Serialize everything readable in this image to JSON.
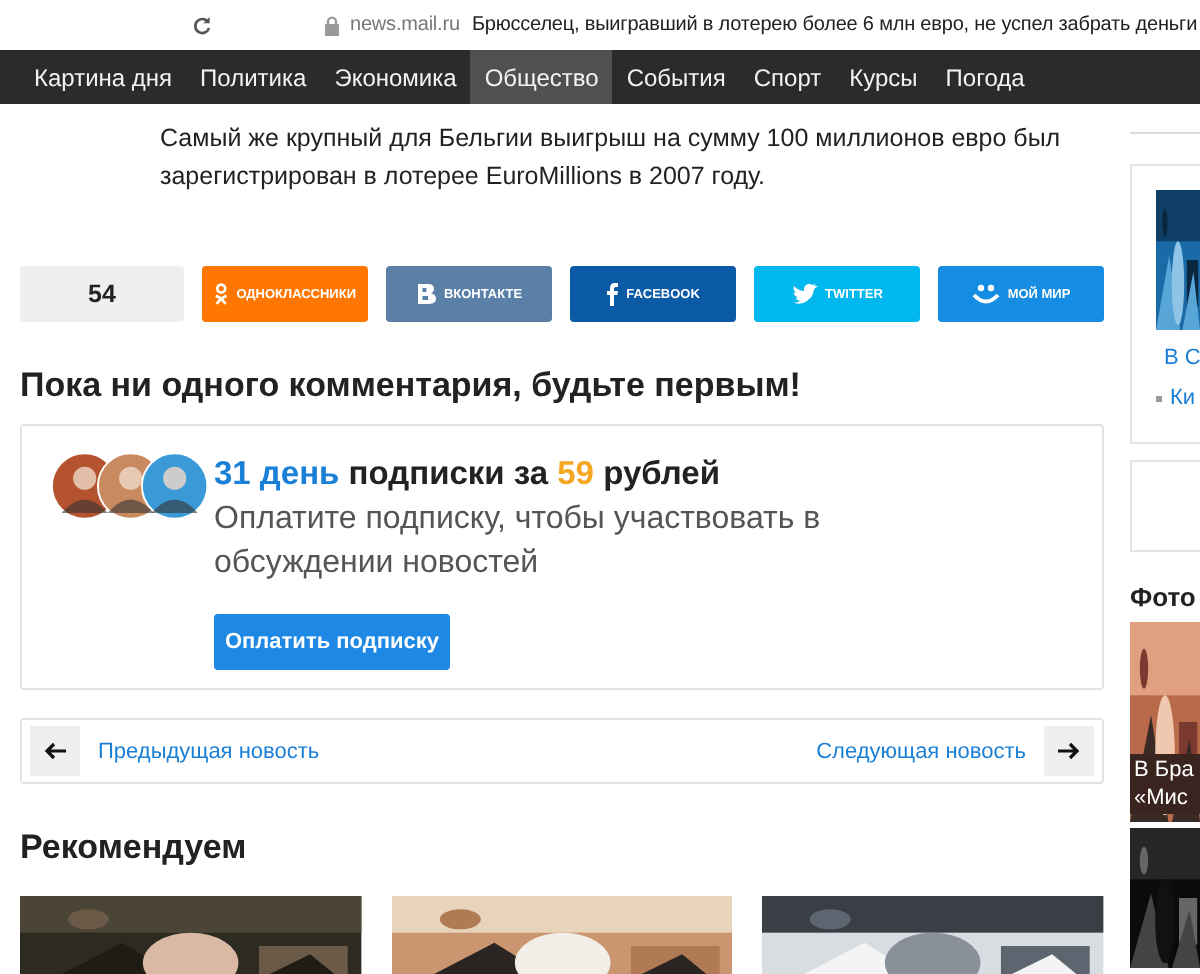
{
  "browser": {
    "url": "news.mail.ru",
    "title": "Брюсселец, выигравший в лотерею более 6 млн евро, не успел забрать деньги"
  },
  "nav": [
    {
      "label": "Картина дня",
      "selected": false
    },
    {
      "label": "Политика",
      "selected": false
    },
    {
      "label": "Экономика",
      "selected": false
    },
    {
      "label": "Общество",
      "selected": true
    },
    {
      "label": "События",
      "selected": false
    },
    {
      "label": "Спорт",
      "selected": false
    },
    {
      "label": "Курсы",
      "selected": false
    },
    {
      "label": "Погода",
      "selected": false
    }
  ],
  "article": {
    "paragraph": "Самый же крупный для Бельгии выигрыш на сумму 100 миллионов евро был зарегистрирован в лотерее EuroMillions в 2007 году."
  },
  "share": {
    "count": "54",
    "buttons": [
      {
        "kind": "ok",
        "label": "ОДНОКЛАССНИКИ"
      },
      {
        "kind": "vk",
        "label": "ВКОНТАКТЕ"
      },
      {
        "kind": "fb",
        "label": "FACEBOOK"
      },
      {
        "kind": "tw",
        "label": "TWITTER"
      },
      {
        "kind": "mm",
        "label": "МОЙ МИР"
      }
    ]
  },
  "comments": {
    "heading": "Пока ни одного комментария, будьте первым!"
  },
  "subscription": {
    "days": "31 день",
    "middle": "подписки за",
    "price": "59",
    "tail": "рублей",
    "description": "Оплатите подписку, чтобы участвовать в обсуждении новостей",
    "button": "Оплатить подписку"
  },
  "pager": {
    "prev": "Предыдущая новость",
    "next": "Следующая новость"
  },
  "recommend": {
    "heading": "Рекомендуем"
  },
  "sidebar": {
    "links": [
      "В С",
      "Ки"
    ],
    "photos_heading": "Фото",
    "caption": [
      "В Бра",
      "«Мис"
    ]
  }
}
